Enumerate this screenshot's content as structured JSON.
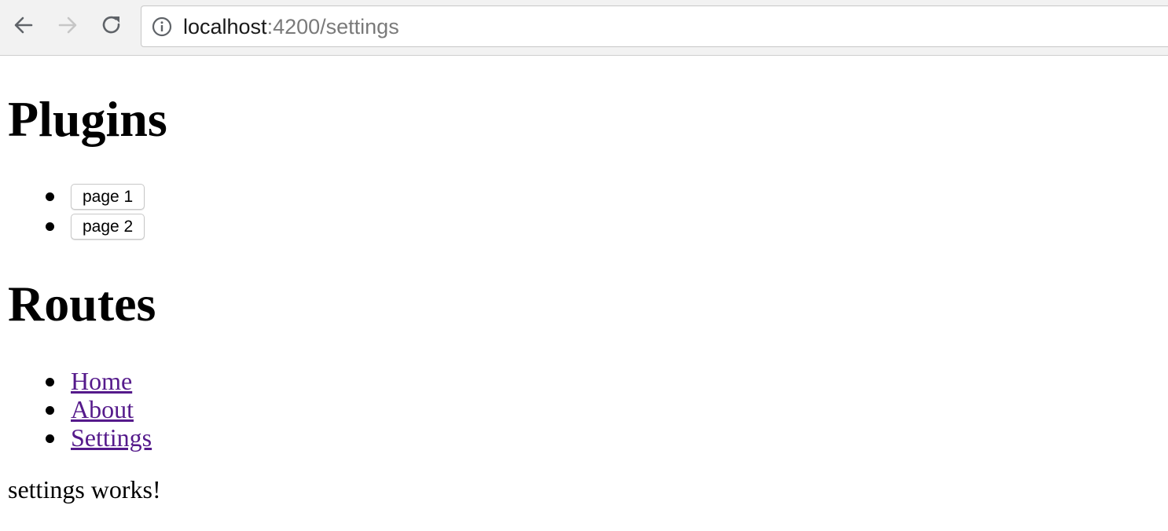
{
  "browser": {
    "url_host": "localhost",
    "url_rest": ":4200/settings",
    "icons": {
      "back": "back-arrow-icon",
      "forward": "forward-arrow-icon",
      "reload": "reload-icon",
      "info": "info-icon"
    },
    "colors": {
      "toolbar_bg": "#f2f2f2",
      "url_rest_color": "#7a7a7a",
      "forward_disabled": "#c6c6c6"
    }
  },
  "page": {
    "plugins_heading": "Plugins",
    "plugins": [
      {
        "label": "page 1"
      },
      {
        "label": "page 2"
      }
    ],
    "routes_heading": "Routes",
    "routes": [
      {
        "label": "Home"
      },
      {
        "label": "About"
      },
      {
        "label": "Settings"
      }
    ],
    "status": "settings works!",
    "colors": {
      "visited_link": "#551a8b"
    }
  }
}
